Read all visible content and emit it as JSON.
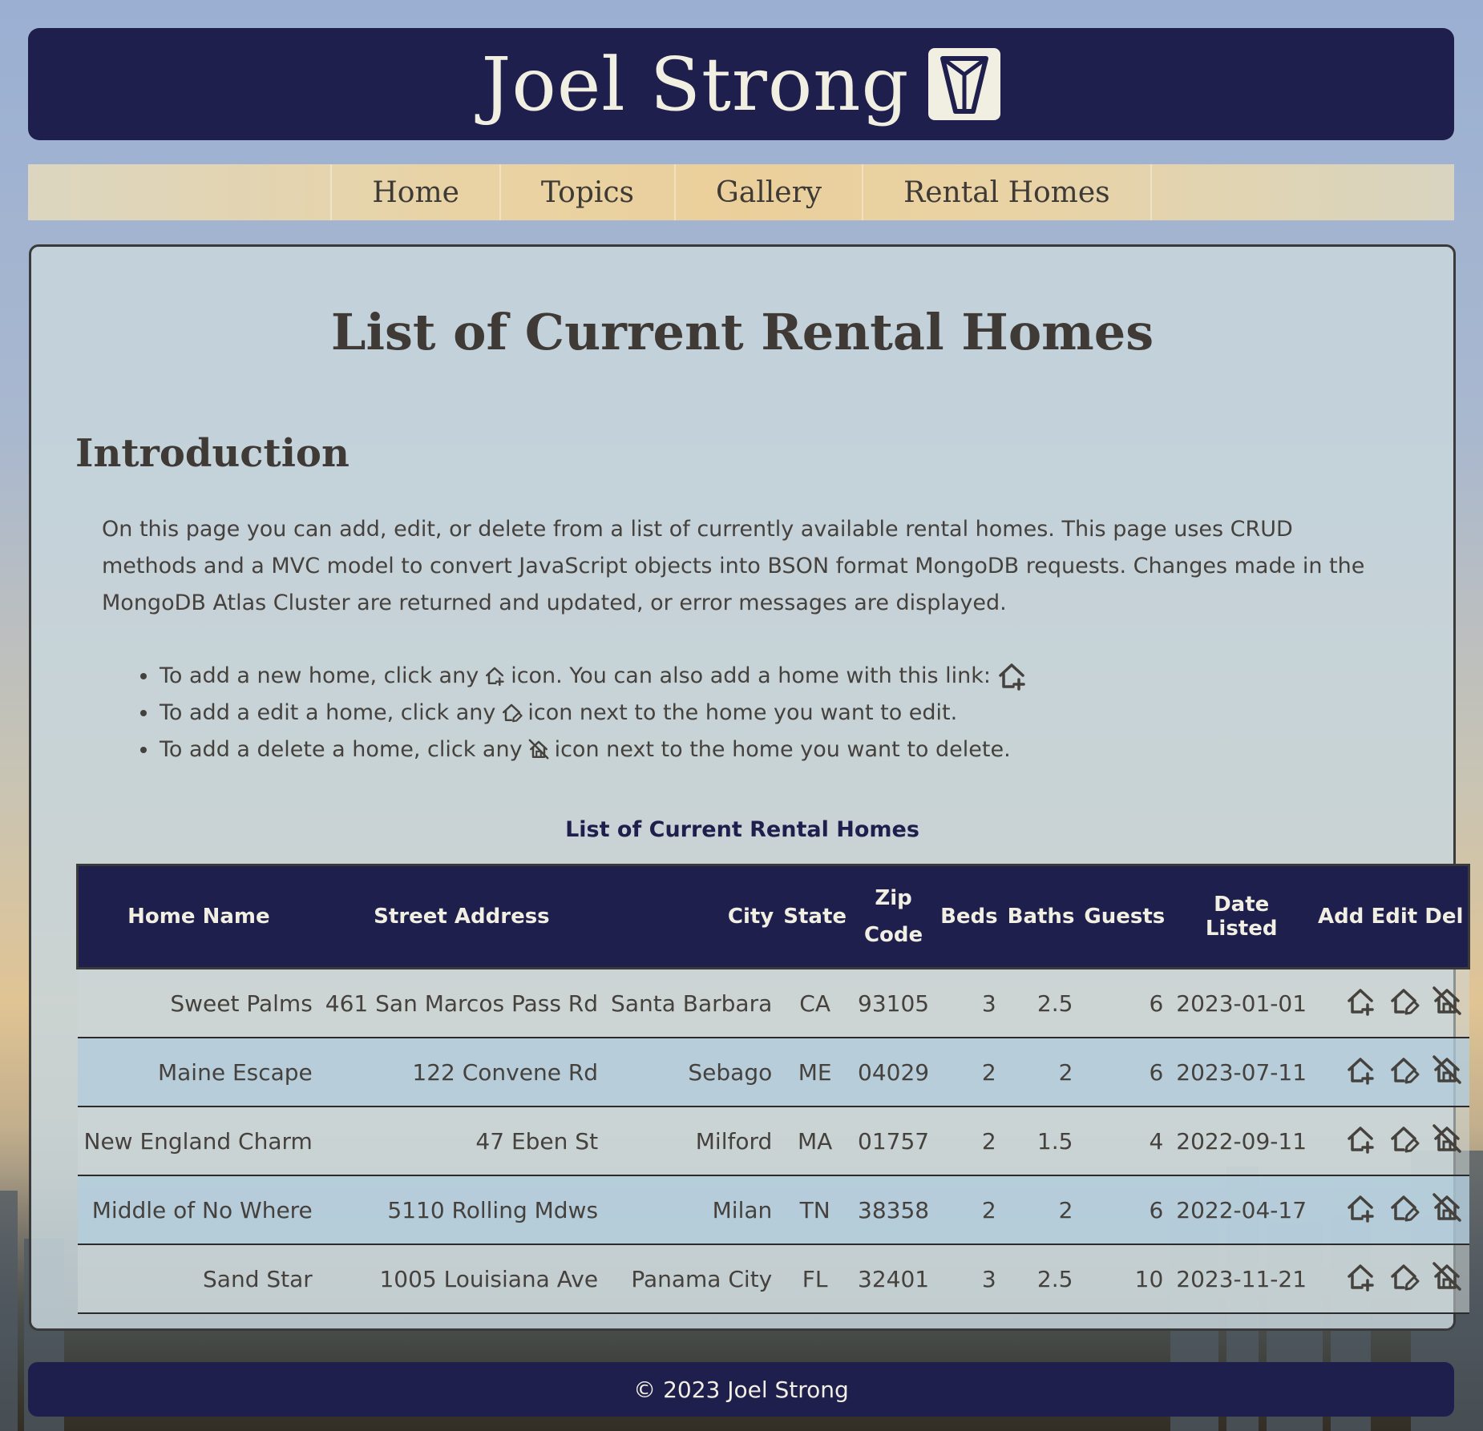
{
  "site": {
    "title": "Joel Strong"
  },
  "nav": {
    "items": [
      "Home",
      "Topics",
      "Gallery",
      "Rental Homes"
    ]
  },
  "main": {
    "title": "List of Current Rental Homes",
    "intro_heading": "Introduction",
    "intro_text": "On this page you can add, edit, or delete from a list of currently available rental homes. This page uses CRUD methods and a MVC model to convert JavaScript objects into BSON format MongoDB requests. Changes made in the MongoDB Atlas Cluster are returned and updated, or error messages are displayed.",
    "instructions": {
      "add_before": "To add a new home, click any",
      "add_after": "icon. You can also add a home with this link:",
      "edit_before": "To add a edit a home, click any",
      "edit_after": "icon next to the home you want to edit.",
      "delete_before": "To add a delete a home, click any",
      "delete_after": "icon next to the home you want to delete."
    },
    "table_caption": "List of Current Rental Homes"
  },
  "table": {
    "headers": [
      "Home Name",
      "Street Address",
      "City",
      "State",
      "Zip Code",
      "Beds",
      "Baths",
      "Guests",
      "Date Listed",
      "Add",
      "Edit",
      "Del"
    ],
    "rows": [
      [
        "Sweet Palms",
        "461 San Marcos Pass Rd",
        "Santa Barbara",
        "CA",
        "93105",
        "3",
        "2.5",
        "6",
        "2023-01-01"
      ],
      [
        "Maine Escape",
        "122 Convene Rd",
        "Sebago",
        "ME",
        "04029",
        "2",
        "2",
        "6",
        "2023-07-11"
      ],
      [
        "New England Charm",
        "47 Eben St",
        "Milford",
        "MA",
        "01757",
        "2",
        "1.5",
        "4",
        "2022-09-11"
      ],
      [
        "Middle of No Where",
        "5110 Rolling Mdws",
        "Milan",
        "TN",
        "38358",
        "2",
        "2",
        "6",
        "2022-04-17"
      ],
      [
        "Sand Star",
        "1005 Louisiana Ave",
        "Panama City",
        "FL",
        "32401",
        "3",
        "2.5",
        "10",
        "2023-11-21"
      ]
    ]
  },
  "footer": {
    "text": "© 2023 Joel Strong"
  },
  "icons": {
    "add": "house-add-icon",
    "edit": "house-edit-icon",
    "delete": "house-delete-icon",
    "logo": "shield-logo-icon"
  },
  "colors": {
    "navy": "#1e1f4d",
    "cream": "#f1eee2",
    "text": "#45413d",
    "nav_gold": "#ebcf9b"
  }
}
